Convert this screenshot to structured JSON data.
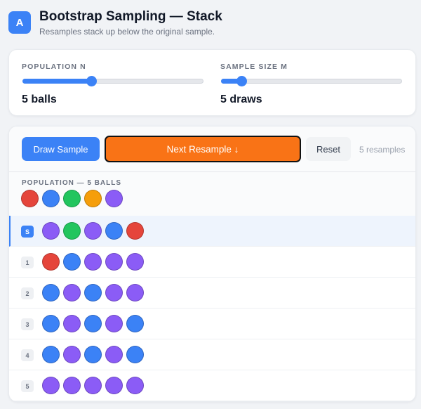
{
  "header": {
    "logo_letter": "A",
    "title": "Bootstrap Sampling — Stack",
    "subtitle": "Resamples stack up below the original sample."
  },
  "controls": {
    "population": {
      "label": "POPULATION N",
      "value_text": "5 balls",
      "slider_fraction": 0.38
    },
    "sample_size": {
      "label": "SAMPLE SIZE M",
      "value_text": "5 draws",
      "slider_fraction": 0.11
    }
  },
  "toolbar": {
    "draw_label": "Draw Sample",
    "next_label": "Next Resample ↓",
    "reset_label": "Reset",
    "count_text": "5 resamples"
  },
  "colors": {
    "red": "#e5453b",
    "blue": "#3b82f6",
    "green": "#22c55e",
    "orange": "#f59e0b",
    "purple": "#8b5cf6",
    "accent": "#3b82f6",
    "next_button": "#f97316"
  },
  "population": {
    "label": "POPULATION — 5 BALLS",
    "balls": [
      "red",
      "blue",
      "green",
      "orange",
      "purple"
    ]
  },
  "rows": [
    {
      "badge": "S",
      "kind": "sample",
      "balls": [
        "purple",
        "green",
        "purple",
        "blue",
        "red"
      ]
    },
    {
      "badge": "1",
      "kind": "resample",
      "balls": [
        "red",
        "blue",
        "purple",
        "purple",
        "purple"
      ]
    },
    {
      "badge": "2",
      "kind": "resample",
      "balls": [
        "blue",
        "purple",
        "blue",
        "purple",
        "purple"
      ]
    },
    {
      "badge": "3",
      "kind": "resample",
      "balls": [
        "blue",
        "purple",
        "blue",
        "purple",
        "blue"
      ]
    },
    {
      "badge": "4",
      "kind": "resample",
      "balls": [
        "blue",
        "purple",
        "blue",
        "purple",
        "blue"
      ]
    },
    {
      "badge": "5",
      "kind": "resample",
      "balls": [
        "purple",
        "purple",
        "purple",
        "purple",
        "purple"
      ]
    }
  ]
}
